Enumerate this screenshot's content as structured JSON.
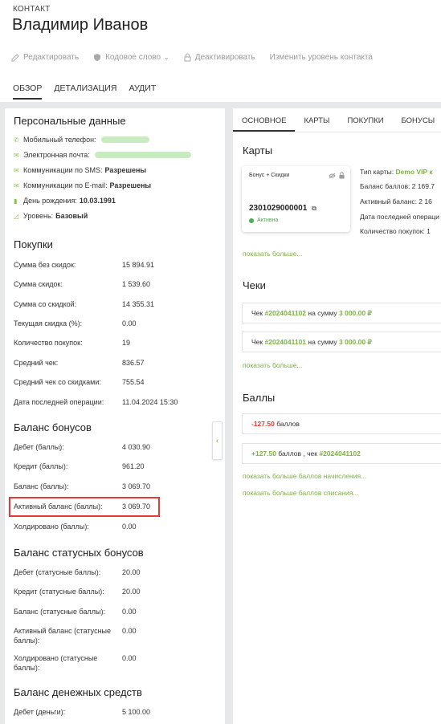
{
  "header": {
    "crumb": "КОНТАКТ",
    "title": "Владимир Иванов",
    "actions": [
      "Редактировать",
      "Кодовое слово",
      "Деактивировать",
      "Изменить уровень контакта"
    ],
    "tabs": [
      "ОБЗОР",
      "ДЕТАЛИЗАЦИЯ",
      "АУДИТ"
    ]
  },
  "personal": {
    "title": "Персональные данные",
    "phone_label": "Мобильный телефон:",
    "email_label": "Электронная почта:",
    "sms_label": "Коммуникации по SMS:",
    "sms_value": "Разрешены",
    "emailcomm_label": "Коммуникации по E-mail:",
    "emailcomm_value": "Разрешены",
    "birthday_label": "День рождения:",
    "birthday_value": "10.03.1991",
    "level_label": "Уровень:",
    "level_value": "Базовый"
  },
  "purchases": {
    "title": "Покупки",
    "rows": [
      {
        "label": "Сумма без скидок:",
        "value": "15 894.91"
      },
      {
        "label": "Сумма скидок:",
        "value": "1 539.60"
      },
      {
        "label": "Сумма со скидкой:",
        "value": "14 355.31"
      },
      {
        "label": "Текущая скидка (%):",
        "value": "0.00"
      },
      {
        "label": "Количество покупок:",
        "value": "19"
      },
      {
        "label": "Средний чек:",
        "value": "836.57"
      },
      {
        "label": "Средний чек со скидками:",
        "value": "755.54"
      },
      {
        "label": "Дата последней операции:",
        "value": "11.04.2024 15:30"
      }
    ]
  },
  "bonus": {
    "title": "Баланс бонусов",
    "rows": [
      {
        "label": "Дебет (баллы):",
        "value": "4 030.90"
      },
      {
        "label": "Кредит (баллы):",
        "value": "961.20"
      },
      {
        "label": "Баланс (баллы):",
        "value": "3 069.70"
      },
      {
        "label": "Активный баланс (баллы):",
        "value": "3 069.70"
      },
      {
        "label": "Холдировано (баллы):",
        "value": "0.00"
      }
    ]
  },
  "status_bonus": {
    "title": "Баланс статусных бонусов",
    "rows": [
      {
        "label": "Дебет (статусные баллы):",
        "value": "20.00"
      },
      {
        "label": "Кредит (статусные баллы):",
        "value": "20.00"
      },
      {
        "label": "Баланс (статусные баллы):",
        "value": "0.00"
      },
      {
        "label": "Активный баланс (статусные",
        "label2": "баллы):",
        "value": "0.00"
      },
      {
        "label": "Холдировано (статусные",
        "label2": "баллы):",
        "value": "0.00"
      }
    ]
  },
  "money": {
    "title": "Баланс денежных средств",
    "rows": [
      {
        "label": "Дебет (деньги):",
        "value": "5 100.00"
      }
    ]
  },
  "right": {
    "tabs": [
      "ОСНОВНОЕ",
      "КАРТЫ",
      "ПОКУПКИ",
      "БОНУСЫ"
    ],
    "cards_title": "Карты",
    "card": {
      "type": "Бонус + Скидки",
      "number": "2301029000001",
      "status": "Активна"
    },
    "card_info": {
      "type_label": "Тип карты:",
      "type_value": "Demo VIP к",
      "balance": "Баланс баллов: 2 169.7",
      "active": "Активный баланс: 2 16",
      "last_op": "Дата последней операци",
      "count": "Количество покупок: 1"
    },
    "show_more": "показать больше...",
    "checks_title": "Чеки",
    "checks": [
      {
        "prefix": "Чек",
        "id": "#2024041102",
        "mid": "на сумму",
        "amount": "3 000.00 ₽"
      },
      {
        "prefix": "Чек",
        "id": "#2024041101",
        "mid": "на сумму",
        "amount": "3 000.00 ₽"
      }
    ],
    "points_title": "Баллы",
    "points": [
      {
        "amount": "-127.50",
        "text": "баллов"
      },
      {
        "amount": "+127.50",
        "text": "баллов , чек",
        "id": "#2024041102"
      }
    ],
    "more_accrual": "показать больше баллов начисления...",
    "more_writeoff": "показать больше баллов списания..."
  }
}
